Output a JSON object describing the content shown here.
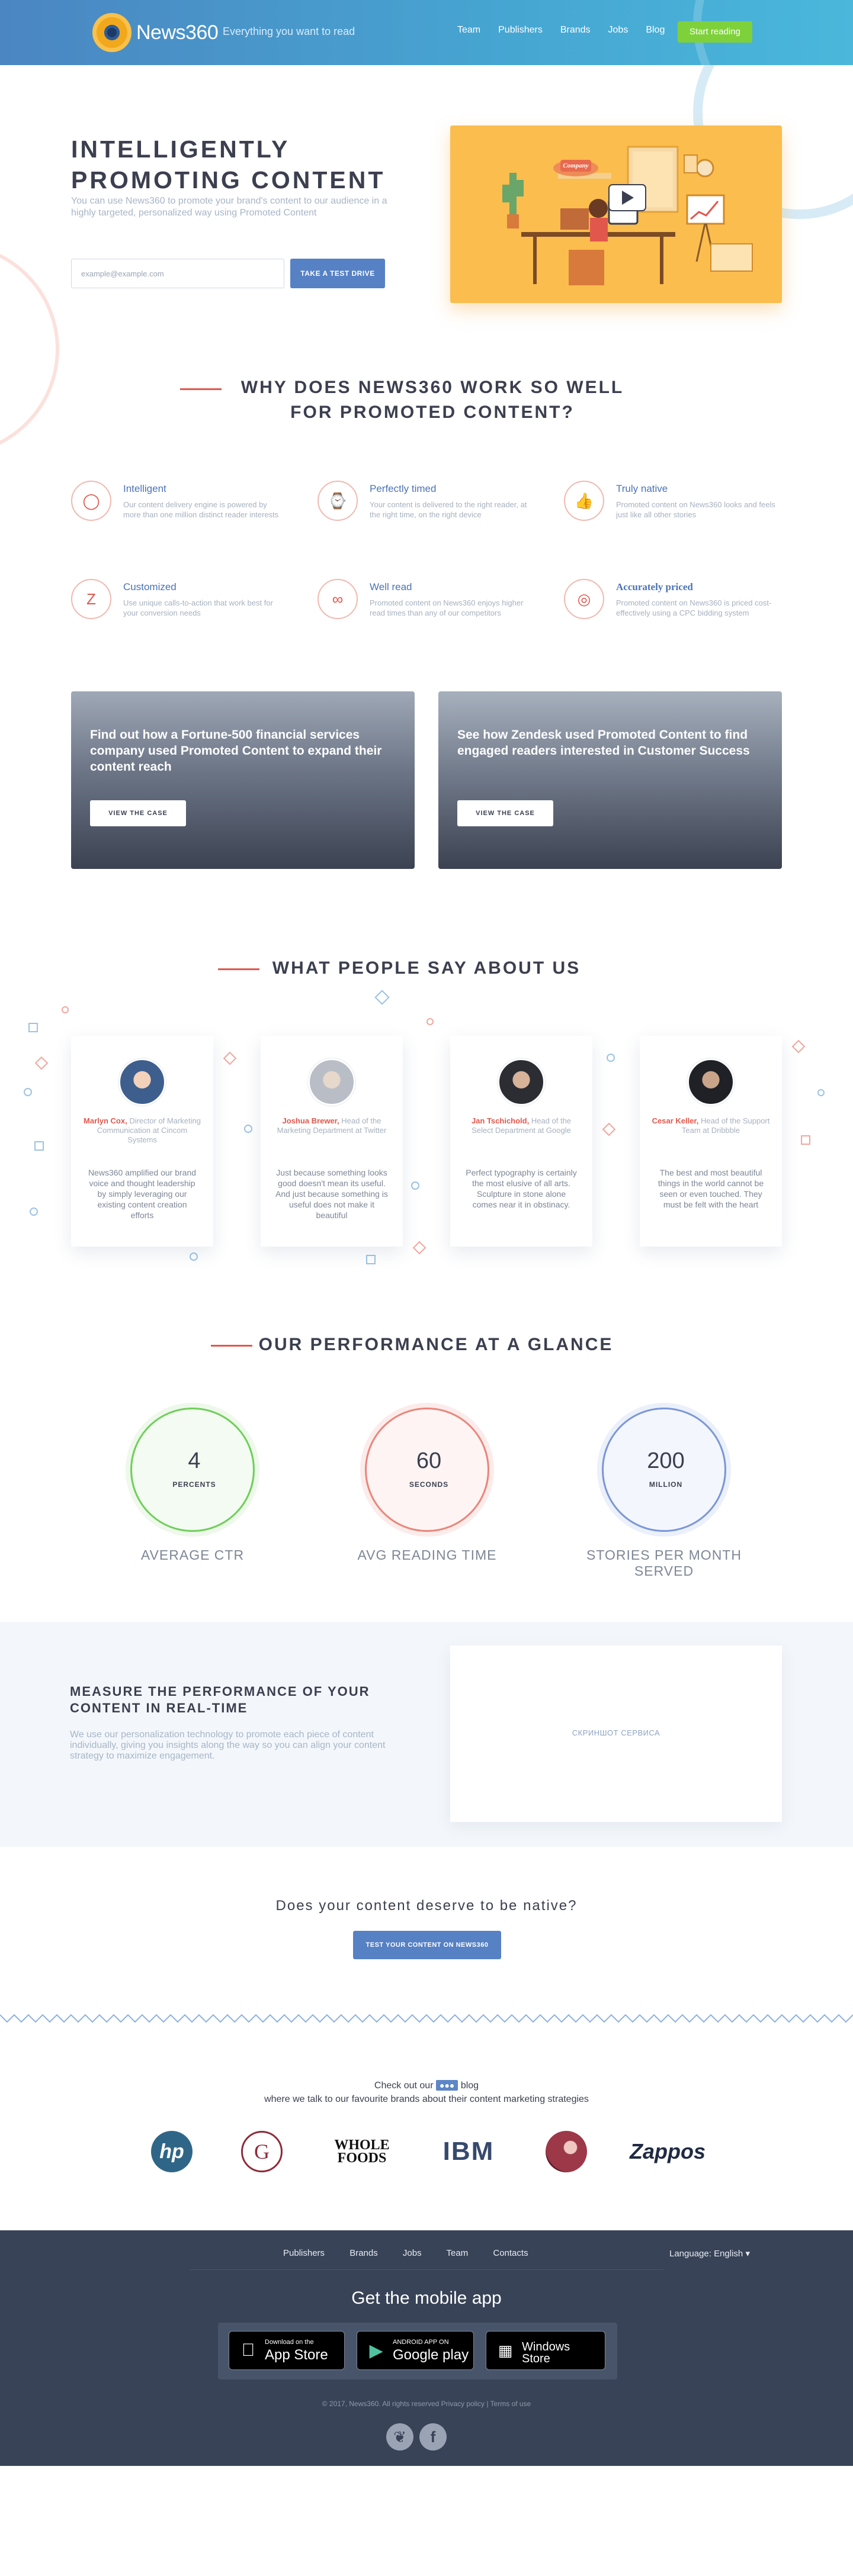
{
  "header": {
    "logo_text": "News360",
    "tagline": "Everything you want to read",
    "nav": [
      "Team",
      "Publishers",
      "Brands",
      "Jobs",
      "Blog"
    ],
    "cta": "Start reading"
  },
  "hero": {
    "title_line1": "INTELLIGENTLY",
    "title_line2": "PROMOTING CONTENT",
    "subtitle": "You can use News360 to promote your brand's content to our audience in a highly targeted, personalized way using Promoted Content",
    "email_placeholder": "example@example.com",
    "button": "TAKE A TEST DRIVE",
    "illustration_badge": "Company"
  },
  "why": {
    "title_line1": "WHY DOES NEWS360 WORK SO WELL",
    "title_line2": "FOR PROMOTED CONTENT?",
    "features": [
      {
        "title": "Intelligent",
        "desc": "Our content delivery engine is powered by more than one million distinct reader interests"
      },
      {
        "title": "Perfectly timed",
        "desc": "Your content is delivered to the right reader, at the right time, on the right device"
      },
      {
        "title": "Truly native",
        "desc": "Promoted content on News360 looks and feels just like all other stories"
      },
      {
        "title": "Customized",
        "desc": "Use unique calls-to-action that work best for your conversion needs"
      },
      {
        "title": "Well read",
        "desc": "Promoted content on News360 enjoys higher read times than any of our competitors"
      },
      {
        "title": "Accurately priced",
        "desc": "Promoted content on News360 is priced cost-effectively using a CPC bidding system"
      }
    ]
  },
  "cases": [
    {
      "text": "Find out how a Fortune-500 financial services company used Promoted Content to expand their content reach",
      "button": "VIEW THE CASE"
    },
    {
      "text": "See how Zendesk used Promoted Content to find engaged readers interested in Customer Success",
      "button": "VIEW THE CASE"
    }
  ],
  "testimonials": {
    "title": "WHAT PEOPLE SAY ABOUT US",
    "items": [
      {
        "name": "Marlyn Cox,",
        "role": "Director of Marketing Communication at Cincom Systems",
        "quote": "News360 amplified our brand voice and thought leadership by simply leveraging our existing content creation efforts"
      },
      {
        "name": "Joshua Brewer,",
        "role": "Head of the Marketing Department at Twitter",
        "quote": "Just because something looks good doesn't mean its useful. And just because something is useful does not make it beautiful"
      },
      {
        "name": "Jan Tschichold,",
        "role": "Head of the Select Department at Google",
        "quote": "Perfect typography is certainly the most elusive of all arts. Sculpture in stone alone comes near it in obstinacy."
      },
      {
        "name": "Cesar Keller,",
        "role": "Head of the Support Team at Dribbble",
        "quote": "The best and most beautiful things in the world cannot be seen or even touched. They must be felt with the heart"
      }
    ]
  },
  "performance": {
    "title": "OUR PERFORMANCE AT A GLANCE",
    "stats": [
      {
        "value": "4",
        "unit": "PERCENTS",
        "label": "AVERAGE CTR",
        "color": "#6fcf5a"
      },
      {
        "value": "60",
        "unit": "SECONDS",
        "label": "AVG READING TIME",
        "color": "#e9867c"
      },
      {
        "value": "200",
        "unit": "MILLION",
        "label": "STORIES PER MONTH SERVED",
        "color": "#7b97d6"
      }
    ]
  },
  "measure": {
    "title": "MEASURE THE PERFORMANCE OF YOUR CONTENT IN REAL-TIME",
    "desc": "We use our personalization technology to promote each piece of content individually, giving you insights along the way so you can align your content strategy to maximize engagement.",
    "screenshot_label": "СКРИНШОТ СЕРВИСА"
  },
  "native": {
    "question": "Does your content deserve to be native?",
    "button": "TEST YOUR CONTENT ON NEWS360"
  },
  "blog": {
    "line1_pre": "Check out our",
    "line1_badge": "",
    "line1_post": "blog",
    "line2": "where we talk to our favourite brands about their content marketing strategies",
    "brands": [
      "hp",
      "G",
      "WHOLE FOODS",
      "IBM",
      "",
      "Zappos"
    ]
  },
  "footer": {
    "nav": [
      "Publishers",
      "Brands",
      "Jobs",
      "Team",
      "Contacts"
    ],
    "language": "Language: English",
    "mobile_title": "Get the mobile app",
    "stores": [
      {
        "small": "Download on the",
        "big": "App Store"
      },
      {
        "small": "ANDROID APP ON",
        "big": "Google play"
      },
      {
        "small": "",
        "big": "Windows Store"
      }
    ],
    "copyright": "© 2017, News360. All rights reserved Privacy policy | Terms of use"
  }
}
